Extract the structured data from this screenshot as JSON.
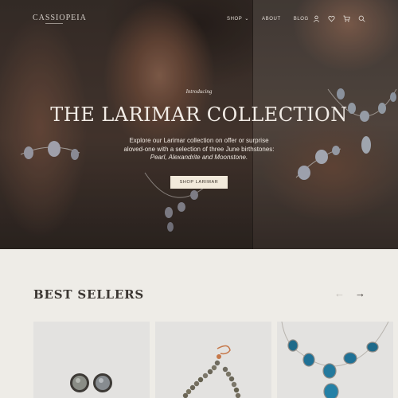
{
  "brand": {
    "name": "CASSIOPEIA"
  },
  "nav": {
    "items": [
      {
        "label": "SHOP",
        "has_dropdown": true
      },
      {
        "label": "ABOUT",
        "has_dropdown": false
      },
      {
        "label": "BLOG",
        "has_dropdown": false
      }
    ],
    "icons": [
      "user-icon",
      "heart-icon",
      "cart-icon",
      "search-icon"
    ]
  },
  "hero": {
    "intro": "Introducing",
    "title": "THE LARIMAR COLLECTION",
    "description_line1": "Explore our Larimar collection on offer or surprise",
    "description_line2": "aloved-one with a selection of three June birthstones:",
    "description_line3": "Pearl, Alexandrite and Moonstone.",
    "cta_label": "SHOP LARIMAR"
  },
  "best_sellers": {
    "title": "BEST SELLERS",
    "prev_arrow": "←",
    "next_arrow": "→",
    "products": [
      {
        "image": "moonstone-stud-earrings"
      },
      {
        "image": "labradorite-beaded-bracelet"
      },
      {
        "image": "turquoise-teardrop-necklace"
      }
    ]
  },
  "colors": {
    "page_background": "#eeece7",
    "cta_background": "#f2eadb",
    "text_dark": "#3b3632",
    "card_background": "#e3e2e0"
  }
}
